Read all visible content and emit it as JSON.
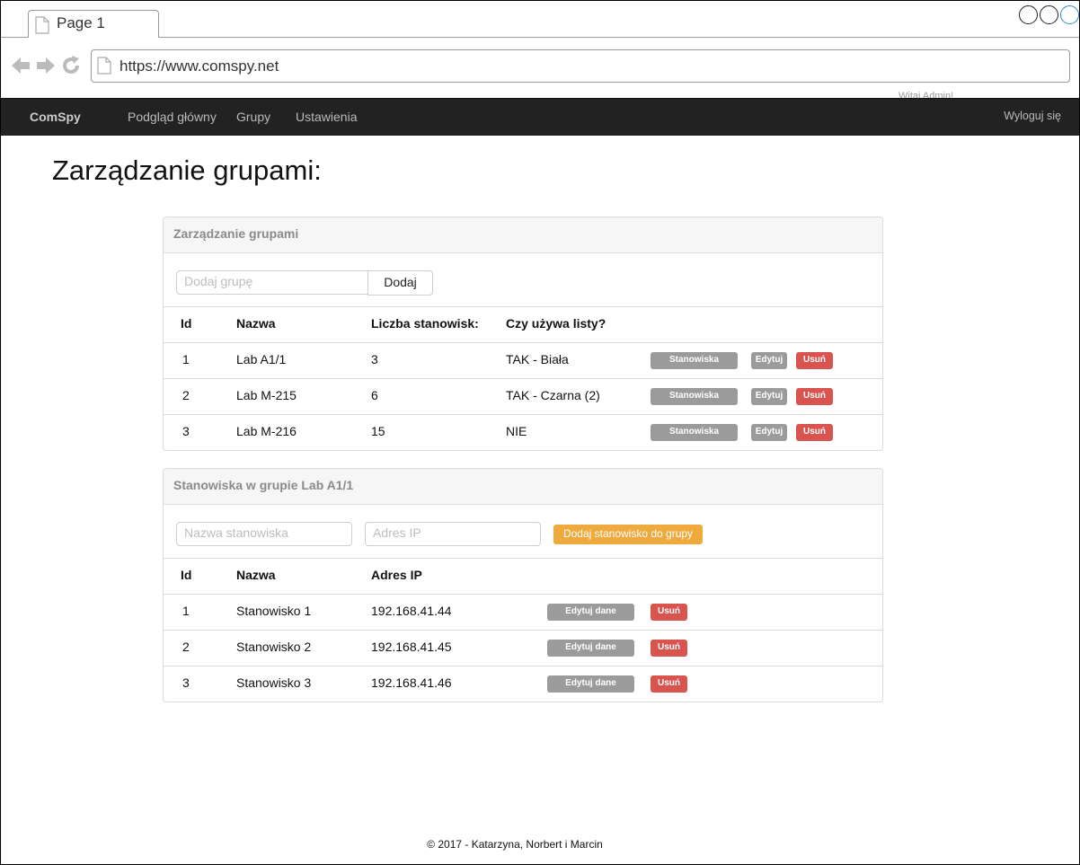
{
  "browser": {
    "tab_title": "Page 1",
    "url": "https://www.comspy.net"
  },
  "navbar": {
    "brand": "ComSpy",
    "links": [
      "Podgląd główny",
      "Grupy",
      "Ustawienia"
    ],
    "welcome": "Witaj Admin!",
    "logout": "Wyloguj się"
  },
  "page_title": "Zarządzanie grupami:",
  "groups_panel": {
    "heading": "Zarządzanie grupami",
    "add_placeholder": "Dodaj grupę",
    "add_button": "Dodaj",
    "columns": [
      "Id",
      "Nazwa",
      "Liczba stanowisk:",
      "Czy używa listy?"
    ],
    "rows": [
      {
        "id": "1",
        "name": "Lab A1/1",
        "count": "3",
        "list": "TAK - Biała"
      },
      {
        "id": "2",
        "name": "Lab M-215",
        "count": "6",
        "list": "TAK - Czarna (2)"
      },
      {
        "id": "3",
        "name": "Lab M-216",
        "count": "15",
        "list": "NIE"
      }
    ],
    "btn_stations": "Stanowiska",
    "btn_edit": "Edytuj",
    "btn_delete": "Usuń"
  },
  "stations_panel": {
    "heading": "Stanowiska w grupie Lab A1/1",
    "name_placeholder": "Nazwa stanowiska",
    "ip_placeholder": "Adres IP",
    "add_button": "Dodaj stanowisko do grupy",
    "columns": [
      "Id",
      "Nazwa",
      "Adres IP"
    ],
    "rows": [
      {
        "id": "1",
        "name": "Stanowisko 1",
        "ip": "192.168.41.44"
      },
      {
        "id": "2",
        "name": "Stanowisko 2",
        "ip": "192.168.41.45"
      },
      {
        "id": "3",
        "name": "Stanowisko 3",
        "ip": "192.168.41.46"
      }
    ],
    "btn_edit": "Edytuj dane",
    "btn_delete": "Usuń"
  },
  "footer": "© 2017 - Katarzyna, Norbert i Marcin",
  "colors": {
    "navbar": "#222222",
    "warning": "#efaa3d",
    "danger": "#d9534f",
    "gray_button": "#9b9b9b"
  },
  "icons": [
    "page-icon",
    "back-arrow-icon",
    "forward-arrow-icon",
    "reload-icon",
    "window-circle-icon"
  ]
}
